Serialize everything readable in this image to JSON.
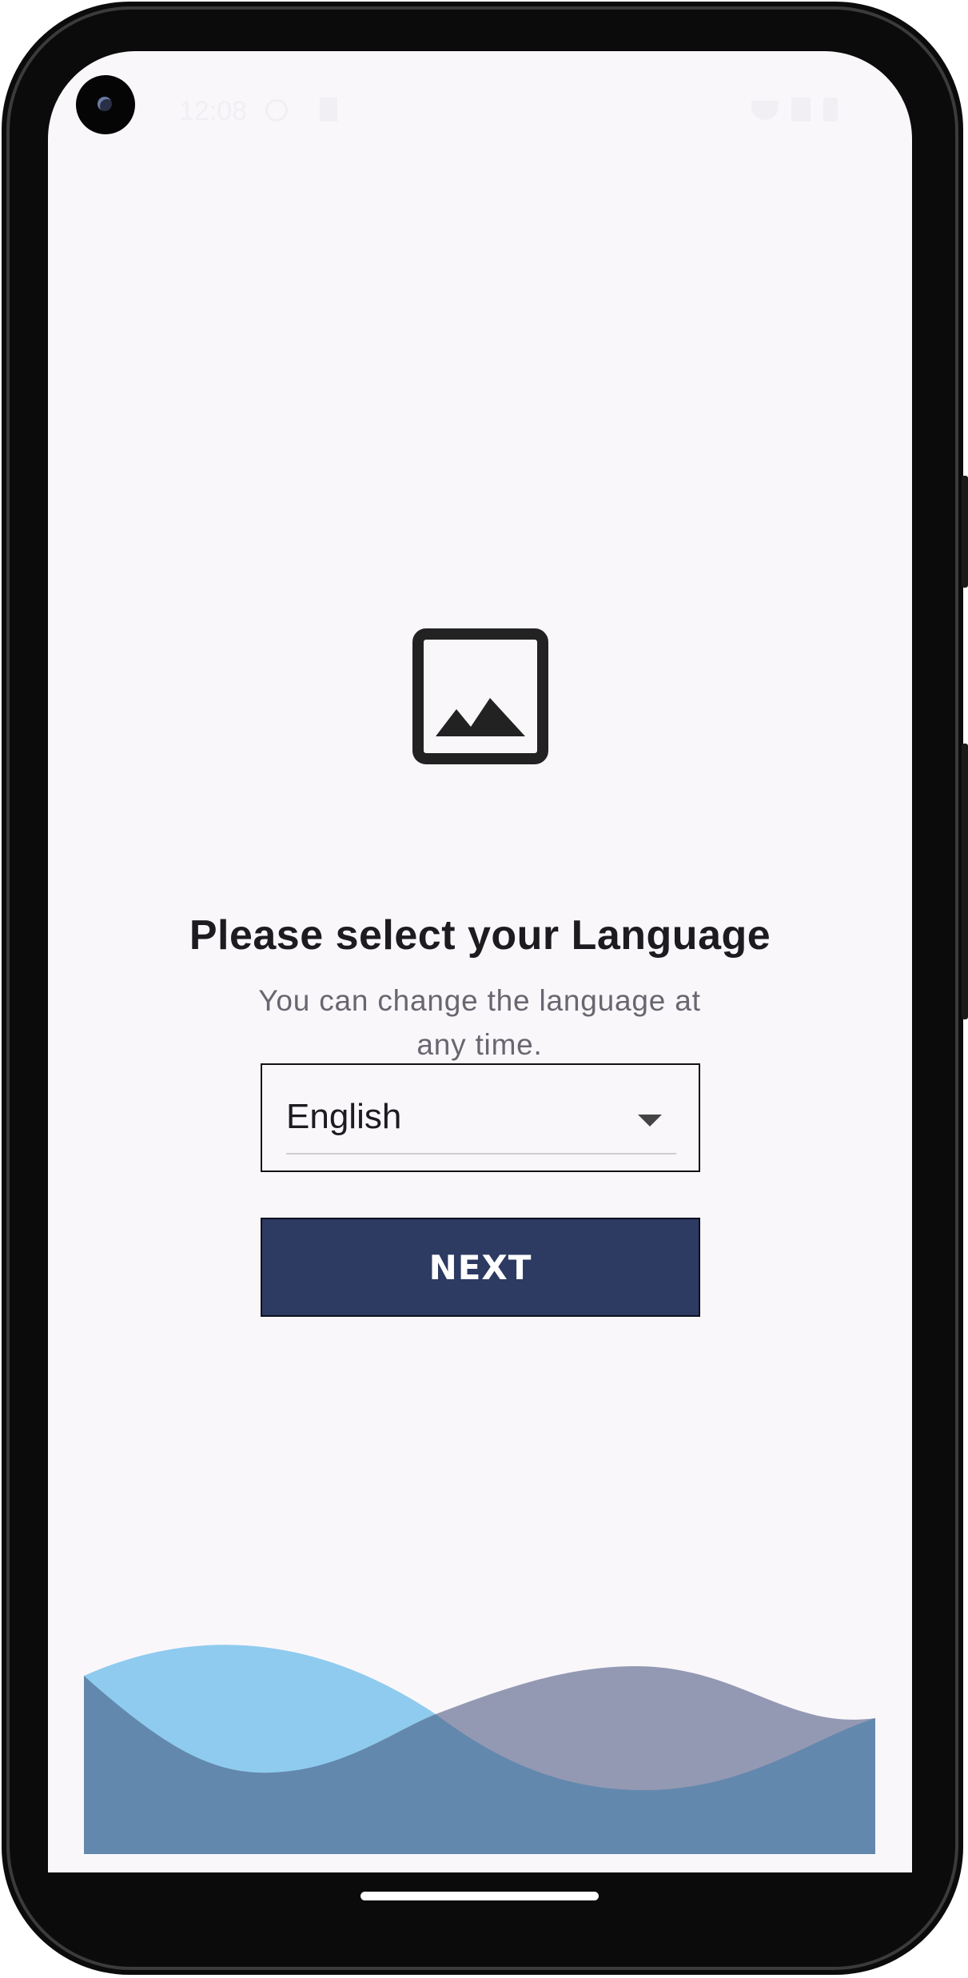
{
  "status_bar": {
    "time": "12:08"
  },
  "onboarding": {
    "logo_icon": "image-placeholder-icon",
    "title": "Please select your Language",
    "subtitle": "You can change the language at any time.",
    "language_select": {
      "value": "English",
      "icon": "arrow-drop-down-icon"
    },
    "next_label": "NEXT"
  },
  "colors": {
    "background": "#faf7fb",
    "primary": "#2d3a62",
    "wave_light_blue": "#8fcbee",
    "wave_grey_blue": "#9499b3",
    "wave_dark": "#6388ad"
  }
}
